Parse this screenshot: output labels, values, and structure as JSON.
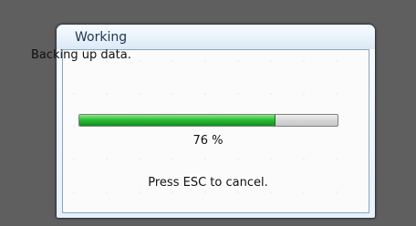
{
  "dialog": {
    "title": "Working",
    "message": "Backing up data.",
    "progress": {
      "value": 76,
      "label": "76 %"
    },
    "cancel_hint": "Press ESC to cancel."
  }
}
